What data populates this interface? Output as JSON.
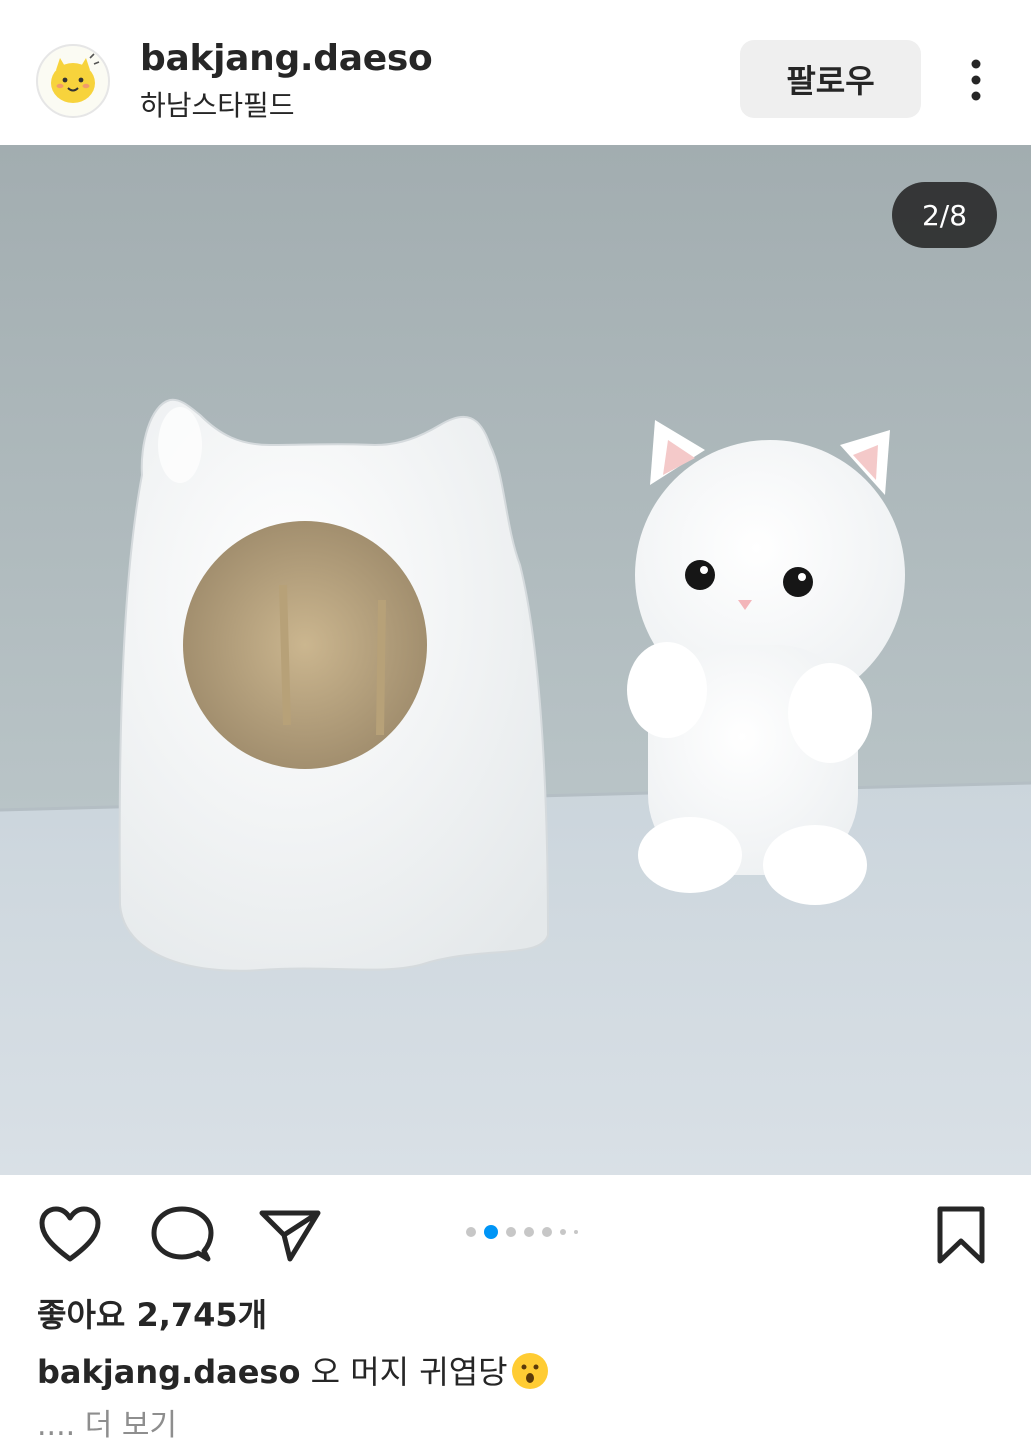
{
  "header": {
    "username": "bakjang.daeso",
    "location": "하남스타필드",
    "follow_label": "팔로우",
    "more_icon": "more-vertical-icon"
  },
  "media": {
    "counter": "2/8",
    "description_icon": "photo"
  },
  "actions": {
    "like_icon": "heart-icon",
    "comment_icon": "comment-icon",
    "share_icon": "send-icon",
    "save_icon": "bookmark-icon",
    "carousel_total": 8,
    "carousel_index": 2
  },
  "post": {
    "likes": "좋아요 2,745개",
    "caption_user": "bakjang.daeso",
    "caption_text": " 오 머지 귀엽당",
    "caption_emoji": "hushed-face-emoji",
    "more_prefix": "....",
    "more_label": " 더 보기"
  },
  "colors": {
    "accent": "#0095f6",
    "text": "#262626",
    "muted": "#8e8e8e",
    "button_bg": "#efefef"
  }
}
